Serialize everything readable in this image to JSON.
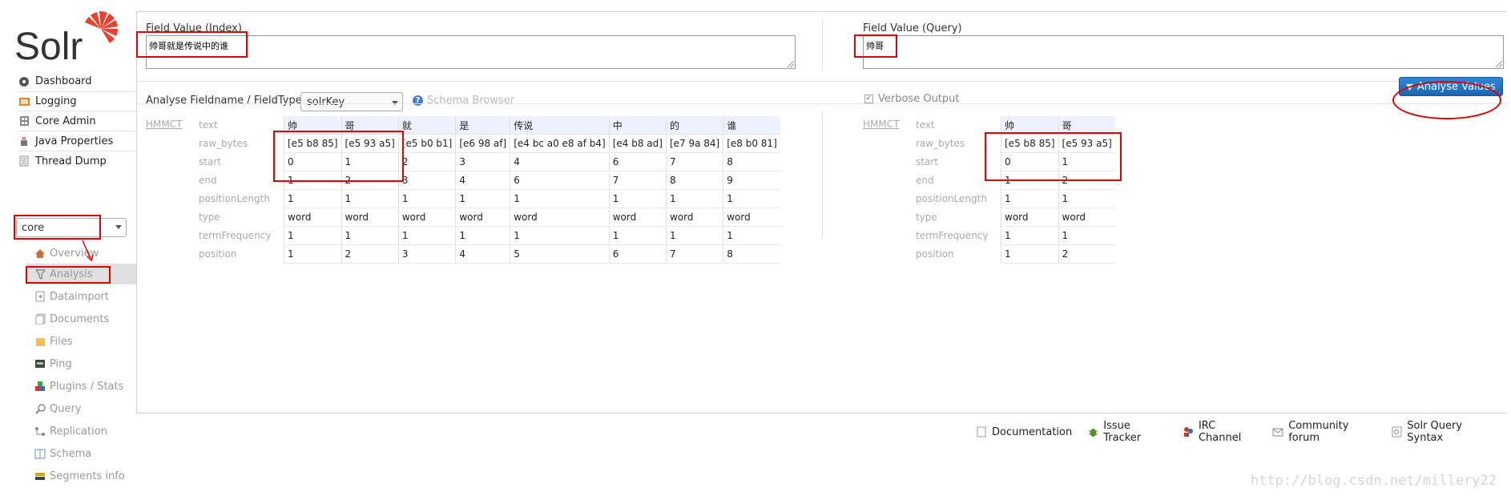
{
  "sidebar": {
    "logo_text": "Solr",
    "nav": [
      {
        "label": "Dashboard",
        "icon": "dashboard-icon"
      },
      {
        "label": "Logging",
        "icon": "logging-icon"
      },
      {
        "label": "Core Admin",
        "icon": "core-admin-icon"
      },
      {
        "label": "Java Properties",
        "icon": "java-properties-icon"
      },
      {
        "label": "Thread Dump",
        "icon": "thread-dump-icon"
      }
    ],
    "core_select_value": "core",
    "core_menu": [
      {
        "label": "Overview",
        "icon": "home-icon"
      },
      {
        "label": "Analysis",
        "icon": "filter-icon"
      },
      {
        "label": "Dataimport",
        "icon": "dataimport-icon"
      },
      {
        "label": "Documents",
        "icon": "documents-icon"
      },
      {
        "label": "Files",
        "icon": "folder-icon"
      },
      {
        "label": "Ping",
        "icon": "ping-icon"
      },
      {
        "label": "Plugins / Stats",
        "icon": "plugins-icon"
      },
      {
        "label": "Query",
        "icon": "search-icon"
      },
      {
        "label": "Replication",
        "icon": "replication-icon"
      },
      {
        "label": "Schema",
        "icon": "schema-icon"
      },
      {
        "label": "Segments info",
        "icon": "segments-icon"
      }
    ]
  },
  "analysis": {
    "index_label": "Field Value (Index)",
    "index_value": "帅哥就是传说中的谁",
    "query_label": "Field Value (Query)",
    "query_value": "帅哥",
    "fieldname_label": "Analyse Fieldname / FieldType:",
    "fieldtype_value": "solrKey",
    "schema_browser": "Schema Browser",
    "verbose_label": "Verbose Output",
    "analyse_button": "Analyse Values",
    "row_keys": [
      "text",
      "raw_bytes",
      "start",
      "end",
      "positionLength",
      "type",
      "termFrequency",
      "position"
    ],
    "index_table": {
      "tokenizer": "HMMCT",
      "tokens": [
        [
          "帅",
          "[e5 b8 85]",
          "0",
          "1",
          "1",
          "word",
          "1",
          "1"
        ],
        [
          "哥",
          "[e5 93 a5]",
          "1",
          "2",
          "1",
          "word",
          "1",
          "2"
        ],
        [
          "就",
          "[e5 b0 b1]",
          "2",
          "3",
          "1",
          "word",
          "1",
          "3"
        ],
        [
          "是",
          "[e6 98 af]",
          "3",
          "4",
          "1",
          "word",
          "1",
          "4"
        ],
        [
          "传说",
          "[e4 bc a0 e8 af b4]",
          "4",
          "6",
          "1",
          "word",
          "1",
          "5"
        ],
        [
          "中",
          "[e4 b8 ad]",
          "6",
          "7",
          "1",
          "word",
          "1",
          "6"
        ],
        [
          "的",
          "[e7 9a 84]",
          "7",
          "8",
          "1",
          "word",
          "1",
          "7"
        ],
        [
          "谁",
          "[e8 b0 81]",
          "8",
          "9",
          "1",
          "word",
          "1",
          "8"
        ]
      ]
    },
    "query_table": {
      "tokenizer": "HMMCT",
      "tokens": [
        [
          "帅",
          "[e5 b8 85]",
          "0",
          "1",
          "1",
          "word",
          "1",
          "1"
        ],
        [
          "哥",
          "[e5 93 a5]",
          "1",
          "2",
          "1",
          "word",
          "1",
          "2"
        ]
      ]
    }
  },
  "footer": [
    {
      "label": "Documentation",
      "icon": "documentation-icon"
    },
    {
      "label": "Issue Tracker",
      "icon": "bug-icon"
    },
    {
      "label": "IRC Channel",
      "icon": "irc-icon"
    },
    {
      "label": "Community forum",
      "icon": "mail-icon"
    },
    {
      "label": "Solr Query Syntax",
      "icon": "query-syntax-icon"
    }
  ],
  "watermark": "http://blog.csdn.net/millery22",
  "colors": {
    "accent": "#1f6fbf",
    "annotation": "#e00000",
    "logo": "#e8412c"
  }
}
